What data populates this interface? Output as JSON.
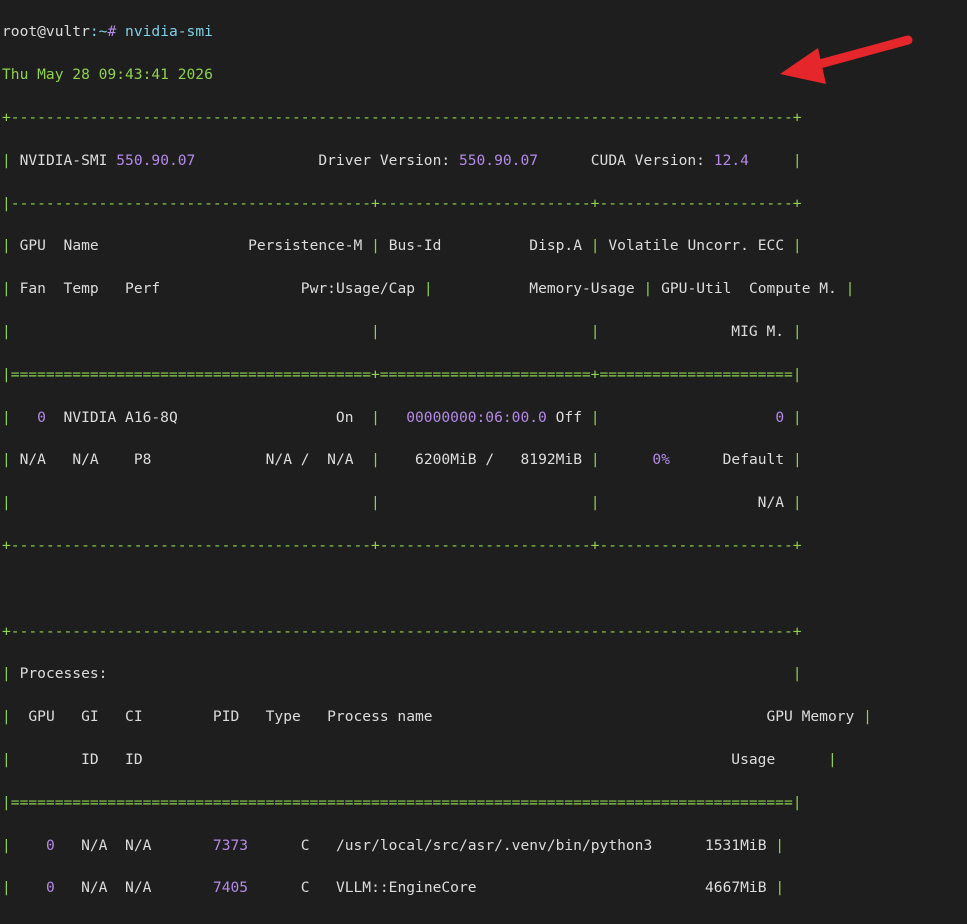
{
  "prompt": {
    "userhost": "root@vultr",
    "path": ":~",
    "symbol": "#",
    "command": "nvidia-smi"
  },
  "timestamp": "Thu May 28 09:43:41 2026",
  "header": {
    "smi_label": "NVIDIA-SMI",
    "smi_version": "550.90.07",
    "driver_label": "Driver Version:",
    "driver_version": "550.90.07",
    "cuda_label": "CUDA Version:",
    "cuda_version": "12.4"
  },
  "gpu_table": {
    "col_headers_row1": [
      "GPU",
      "Name",
      "Persistence-M",
      "Bus-Id",
      "Disp.A",
      "Volatile Uncorr. ECC"
    ],
    "col_headers_row2": [
      "Fan",
      "Temp",
      "Perf",
      "Pwr:Usage/Cap",
      "Memory-Usage",
      "GPU-Util",
      "Compute M."
    ],
    "col_headers_row3": [
      "MIG M."
    ],
    "gpus": [
      {
        "index": "0",
        "name": "NVIDIA A16-8Q",
        "persistence": "On",
        "bus_id": "00000000:06:00.0",
        "disp": "Off",
        "ecc": "0",
        "fan": "N/A",
        "temp": "N/A",
        "perf": "P8",
        "pwr_usage": "N/A",
        "pwr_cap": "N/A",
        "mem_used": "6200MiB",
        "mem_total": "8192MiB",
        "util": "0%",
        "compute_mode": "Default",
        "mig_mode": "N/A"
      }
    ]
  },
  "processes": {
    "title": "Processes:",
    "headers": [
      "GPU",
      "GI",
      "CI",
      "PID",
      "Type",
      "Process name",
      "GPU Memory"
    ],
    "headers_row2": [
      "ID",
      "ID",
      "Usage"
    ],
    "rows": [
      {
        "gpu": "0",
        "gi": "N/A",
        "ci": "N/A",
        "pid": "7373",
        "type": "C",
        "name": "/usr/local/src/asr/.venv/bin/python3",
        "mem": "1531MiB"
      },
      {
        "gpu": "0",
        "gi": "N/A",
        "ci": "N/A",
        "pid": "7405",
        "type": "C",
        "name": "VLLM::EngineCore",
        "mem": "4667MiB"
      }
    ]
  },
  "colors": {
    "background": "#1e1e1e",
    "border": "#8fd14f",
    "number": "#b48ae8",
    "arrow": "#e5262a"
  }
}
